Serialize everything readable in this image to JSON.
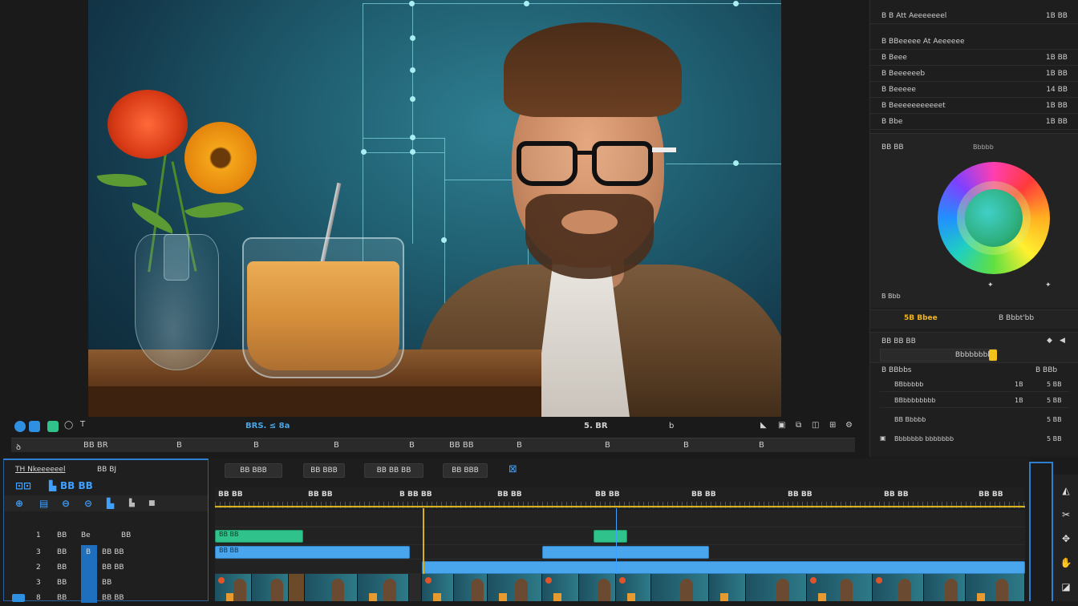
{
  "viewer": {
    "timecode_left": "BRS. ≤ 8a",
    "timecode_mid": "5. BR",
    "timecode_right": "b",
    "ruler_labels": [
      "ꝺ",
      "BB BR",
      "B",
      "B",
      "B",
      "B",
      "B",
      "BB BB",
      "B",
      "B",
      "B",
      "B"
    ]
  },
  "inspector": {
    "rows": [
      {
        "label": "B B Att Aeeeeeeel",
        "value": "1B BB"
      },
      {
        "label": "B BBeeeee At Aeeeeee",
        "value": ""
      },
      {
        "label": "B Beee",
        "value": "1B BB"
      },
      {
        "label": "B Beeeeeeb",
        "value": "1B BB"
      },
      {
        "label": "B Beeeee",
        "value": "14 BB"
      },
      {
        "label": "B Beeeeeeeeeeet",
        "value": "1B BB"
      },
      {
        "label": "B Bbe",
        "value": "1B BB"
      }
    ],
    "color_header": "BB BB",
    "color_mode": "Bbbbb",
    "small_label": "B Bbb",
    "accent_label": "5B Bbee",
    "accent_value": "B Bbbt'bb",
    "section2_title": "BB BB BB",
    "section2_field": "Bbbbbbbb",
    "list_title": "B BBbbs",
    "list_value": "B BBb",
    "list_items": [
      {
        "label": "BBbbbbb",
        "a": "1B",
        "b": "5 BB"
      },
      {
        "label": "BBbbbbbbbb",
        "a": "1B",
        "b": "5 BB"
      },
      {
        "label": "BB Bbbbb",
        "a": "",
        "b": "5 BB"
      },
      {
        "label": "Bbbbbbb bbbbbbb",
        "a": "",
        "b": "5 BB"
      }
    ],
    "accent_color": "#f2b51a"
  },
  "project_panel": {
    "title": "TH Nkeeeeeel",
    "title2": "BB BJ",
    "icon_row": "BB BB",
    "rows": [
      {
        "c1": "1",
        "c2": "BB",
        "c3": "Be",
        "c4": "BB"
      },
      {
        "c1": "3",
        "c2": "BB",
        "c3": "B",
        "c4": "BB BB"
      },
      {
        "c1": "2",
        "c2": "BB",
        "c3": "",
        "c4": "BB BB"
      },
      {
        "c1": "3",
        "c2": "BB",
        "c3": "",
        "c4": "BB"
      },
      {
        "c1": "8",
        "c2": "BB",
        "c3": "",
        "c4": "BB BB"
      }
    ]
  },
  "timeline": {
    "toolbar": [
      "BB BBB",
      "BB BBB",
      "BB BB BB",
      "BB BBB"
    ],
    "ruler": [
      "BB BB",
      "BB BB",
      "B BB BB",
      "BB BB",
      "BB BB",
      "BB BB",
      "BB BB",
      "BB BB",
      "BB BB"
    ],
    "clip_labels": [
      "BB BB",
      "BB BB"
    ]
  }
}
